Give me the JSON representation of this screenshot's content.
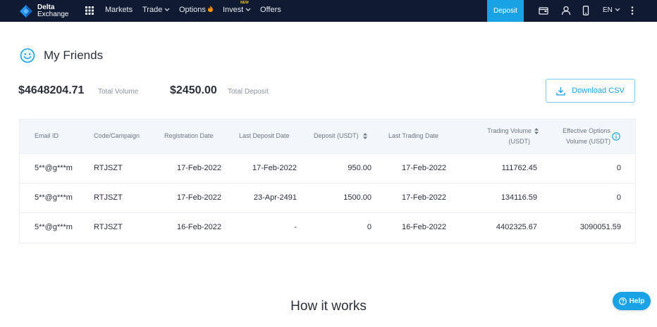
{
  "brand": {
    "line1": "Delta",
    "line2": "Exchange",
    "accent": "#2196f3"
  },
  "nav": {
    "markets": "Markets",
    "trade": "Trade",
    "options": "Options",
    "invest": "Invest",
    "invest_badge": "NEW",
    "offers": "Offers",
    "deposit": "Deposit",
    "language": "EN"
  },
  "page": {
    "title": "My Friends"
  },
  "stats": {
    "total_volume_value": "$4648204.71",
    "total_volume_label": "Total Volume",
    "total_deposit_value": "$2450.00",
    "total_deposit_label": "Total Deposit"
  },
  "download_csv": "Download CSV",
  "table": {
    "headers": {
      "email": "Email ID",
      "code": "Code/Campaign",
      "registration": "Registration Date",
      "last_deposit": "Last Deposit Date",
      "deposit": "Deposit (USDT)",
      "last_trading": "Last Trading Date",
      "trading_volume_l1": "Trading Volume",
      "trading_volume_l2": "(USDT)",
      "effective_l1": "Effective Options",
      "effective_l2": "Volume (USDT)"
    },
    "rows": [
      {
        "email": "5**@g***m",
        "code": "RTJSZT",
        "registration": "17-Feb-2022",
        "last_deposit": "17-Feb-2022",
        "deposit": "950.00",
        "last_trading": "17-Feb-2022",
        "trading_volume": "111762.45",
        "effective": "0"
      },
      {
        "email": "5**@g***m",
        "code": "RTJSZT",
        "registration": "17-Feb-2022",
        "last_deposit": "23-Apr-2491",
        "deposit": "1500.00",
        "last_trading": "17-Feb-2022",
        "trading_volume": "134116.59",
        "effective": "0"
      },
      {
        "email": "5**@g***m",
        "code": "RTJSZT",
        "registration": "16-Feb-2022",
        "last_deposit": "-",
        "deposit": "0",
        "last_trading": "16-Feb-2022",
        "trading_volume": "4402325.67",
        "effective": "3090051.59"
      }
    ]
  },
  "how_it_works": "How it works",
  "help": "Help",
  "colors": {
    "topbar": "#101a32",
    "primary": "#1aa2e6"
  }
}
